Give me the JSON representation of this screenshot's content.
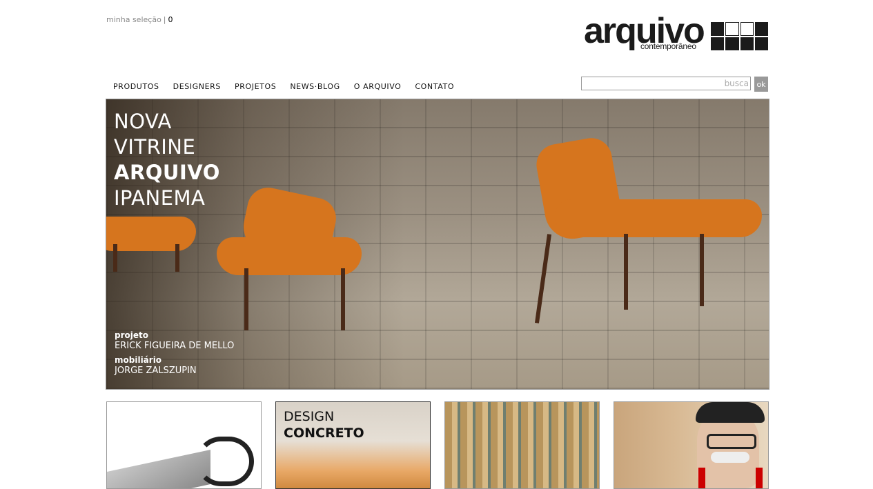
{
  "header": {
    "selection_label": "minha seleção",
    "selection_separator": "|",
    "selection_count": "0",
    "logo": {
      "word": "arquivo",
      "sub": "contemporâneo"
    }
  },
  "nav": {
    "items": [
      {
        "label": "PRODUTOS"
      },
      {
        "label": "DESIGNERS"
      },
      {
        "label": "PROJETOS"
      },
      {
        "label": "NEWS·BLOG"
      },
      {
        "label": "O ARQUIVO"
      },
      {
        "label": "CONTATO"
      }
    ]
  },
  "search": {
    "placeholder": "busca",
    "button_label": "ok"
  },
  "hero": {
    "title_lines": [
      "NOVA",
      "VITRINE",
      "ARQUIVO",
      "IPANEMA"
    ],
    "credits": [
      {
        "label": "projeto",
        "name": "ERICK FIGUEIRA DE MELLO"
      },
      {
        "label": "mobiliário",
        "name": "JORGE ZALSZUPIN"
      }
    ]
  },
  "tiles": [
    {
      "title": "",
      "subtitle": ""
    },
    {
      "title": "DESIGN",
      "subtitle": "CONCRETO"
    },
    {
      "title": "",
      "subtitle": ""
    },
    {
      "title": "",
      "subtitle": ""
    }
  ],
  "colors": {
    "accent_orange": "#d6751e",
    "button_gray": "#999999",
    "logo_dark": "#1b1b1b"
  }
}
